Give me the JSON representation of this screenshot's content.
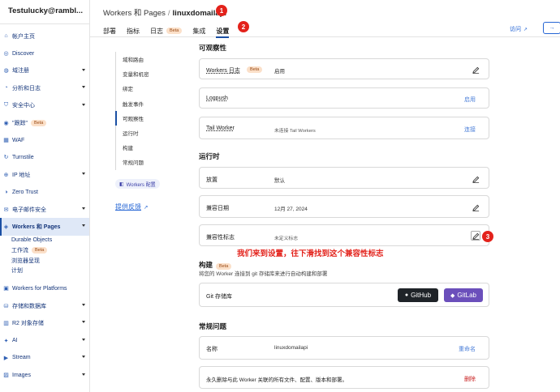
{
  "sidebar": {
    "account": "Testulucky@rambl...",
    "items": [
      {
        "label": "帐户主页",
        "icon": "home-icon",
        "caret": false
      },
      {
        "label": "Discover",
        "icon": "compass-icon",
        "caret": false
      },
      {
        "label": "域注册",
        "icon": "globe-icon",
        "caret": true
      },
      {
        "label": "分析和日志",
        "icon": "chart-icon",
        "caret": true
      },
      {
        "label": "安全中心",
        "icon": "shield-icon",
        "caret": true
      },
      {
        "label": "\"跟踪\"",
        "icon": "radar-icon",
        "caret": false,
        "badge": "Beta"
      },
      {
        "label": "WAF",
        "icon": "firewall-icon",
        "caret": false
      },
      {
        "label": "Turnstile",
        "icon": "turnstile-icon",
        "caret": false
      },
      {
        "label": "IP 地址",
        "icon": "ip-icon",
        "caret": true
      },
      {
        "label": "Zero Trust",
        "icon": "zero-trust-icon",
        "caret": false
      },
      {
        "label": "电子邮件安全",
        "icon": "mail-icon",
        "caret": true
      },
      {
        "label": "Workers 和 Pages",
        "icon": "workers-icon",
        "caret": true,
        "active": true
      },
      {
        "label": "Workers for Platforms",
        "icon": "platforms-icon",
        "caret": false
      },
      {
        "label": "存储和数据库",
        "icon": "database-icon",
        "caret": true
      },
      {
        "label": "R2 对象存储",
        "icon": "bucket-icon",
        "caret": true
      },
      {
        "label": "AI",
        "icon": "ai-icon",
        "caret": true
      },
      {
        "label": "Stream",
        "icon": "stream-icon",
        "caret": true
      },
      {
        "label": "Images",
        "icon": "image-icon",
        "caret": true
      }
    ],
    "sub_items": [
      {
        "label": "Durable Objects"
      },
      {
        "label": "工作流",
        "badge": "Beta"
      },
      {
        "label": "浏览器呈现"
      },
      {
        "label": "计划"
      }
    ]
  },
  "header": {
    "breadcrumb_parent": "Workers 和 Pages",
    "breadcrumb_sep": "/",
    "breadcrumb_current": "linuxdomailapi",
    "tabs": [
      {
        "label": "部署"
      },
      {
        "label": "指标"
      },
      {
        "label": "日志",
        "badge": "Beta"
      },
      {
        "label": "集成"
      },
      {
        "label": "设置",
        "active": true
      }
    ],
    "visit_label": "访问"
  },
  "annotations": {
    "one": "1",
    "two": "2",
    "three": "3",
    "note": "我们来到设置，往下滑找到这个兼容性标志"
  },
  "subnav": {
    "items": [
      {
        "label": "域和路由"
      },
      {
        "label": "变量和机密"
      },
      {
        "label": "绑定"
      },
      {
        "label": "触发事件"
      },
      {
        "label": "可观察性",
        "active": true
      },
      {
        "label": "运行时"
      },
      {
        "label": "构建"
      },
      {
        "label": "常规问题"
      }
    ],
    "workers_config": "Workers 配置",
    "feedback": "提供反馈"
  },
  "observability": {
    "title": "可观察性",
    "logs_label": "Workers 日志",
    "logs_badge": "Beta",
    "logs_value": "启用",
    "logpush_label": "Logpush",
    "logpush_action": "启用",
    "tail_label": "Tail Worker",
    "tail_value": "未连接 Tail Workers",
    "tail_action": "连接"
  },
  "runtime": {
    "title": "运行时",
    "placement_label": "放置",
    "placement_value": "默认",
    "compat_date_label": "兼容日期",
    "compat_date_value": "12月 27, 2024",
    "compat_flags_label": "兼容性标志",
    "compat_flags_value": "未定义标志"
  },
  "build": {
    "title": "构建",
    "badge": "Beta",
    "subtitle": "将您的 Worker 连接到 git 存储库来进行自动构建和部署",
    "git_label": "Git 存储库",
    "github_label": "GitHub",
    "gitlab_label": "GitLab"
  },
  "general": {
    "title": "常规问题",
    "name_label": "名称",
    "name_value": "linuxdomailapi",
    "rename_action": "重命名",
    "delete_text": "永久删除与此 Worker 关联的所有文件、配置、版本和部署。",
    "delete_action": "删除"
  }
}
